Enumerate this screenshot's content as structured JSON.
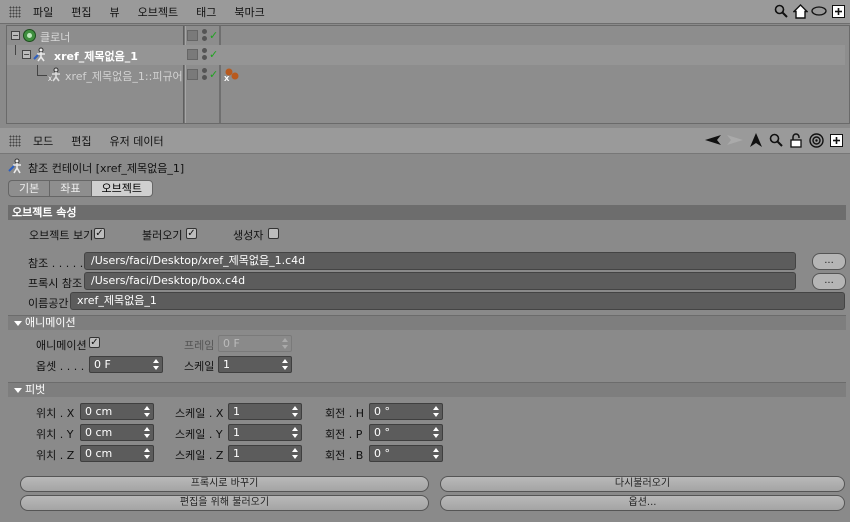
{
  "menubar": {
    "items": [
      "파일",
      "편집",
      "뷰",
      "오브젝트",
      "태그",
      "북마크"
    ]
  },
  "objects": [
    {
      "name": "클로너"
    },
    {
      "name": "xref_제목없음_1"
    },
    {
      "name": "xref_제목없음_1::피규어"
    }
  ],
  "attr_menu": {
    "items": [
      "모드",
      "편집",
      "유저 데이터"
    ]
  },
  "header": {
    "title": "참조 컨테이너 [xref_제목없음_1]"
  },
  "tabs": [
    "기본",
    "좌표",
    "오브젝트"
  ],
  "active_tab": "오브젝트",
  "section": {
    "title": "오브젝트 속성"
  },
  "options": {
    "show_object": "오브젝트 보기",
    "show_object_checked": true,
    "reload": "불러오기",
    "reload_checked": true,
    "generator": "생성자",
    "generator_checked": false
  },
  "reference": {
    "label": "참조 . . . . .",
    "value": "/Users/faci/Desktop/xref_제목없음_1.c4d",
    "proxy_label": "프록시 참조",
    "proxy_value": "/Users/faci/Desktop/box.c4d",
    "namespace_label": "이름공간",
    "namespace_value": "xref_제목없음_1",
    "browse_label": "..."
  },
  "animation": {
    "group_title": "애니메이션",
    "anim_label": "애니메이션",
    "anim_checked": true,
    "frame_label": "프레임",
    "frame_value": "0 F",
    "offset_label": "옵셋 . . . . .",
    "offset_value": "0 F",
    "scale_label": "스케일",
    "scale_value": "1"
  },
  "pivot": {
    "group_title": "피벗",
    "pos_x_label": "위치 . X",
    "pos_x": "0 cm",
    "pos_y_label": "위치 . Y",
    "pos_y": "0 cm",
    "pos_z_label": "위치 . Z",
    "pos_z": "0 cm",
    "scale_x_label": "스케일 . X",
    "scale_x": "1",
    "scale_y_label": "스케일 . Y",
    "scale_y": "1",
    "scale_z_label": "스케일 . Z",
    "scale_z": "1",
    "rot_h_label": "회전 . H",
    "rot_h": "0 °",
    "rot_p_label": "회전 . P",
    "rot_p": "0 °",
    "rot_b_label": "회전 . B",
    "rot_b": "0 °"
  },
  "buttons": {
    "convert_proxy": "프록시로 바꾸기",
    "reload": "다시불러오기",
    "load_for_edit": "편집을 위해 불러오기",
    "options": "옵션..."
  },
  "colors": {
    "check_green": "#1fa31f",
    "accent": "#6d6d6d"
  }
}
